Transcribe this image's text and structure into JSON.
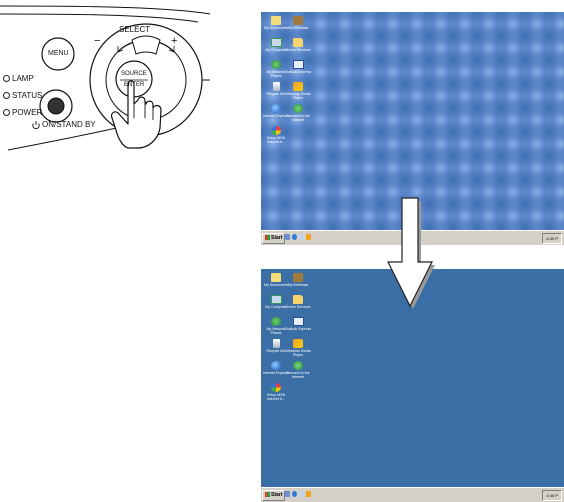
{
  "panel": {
    "select_label": "SELECT",
    "minus_label": "−",
    "plus_label": "+",
    "menu_label": "MENU",
    "source_label": "SOURCE",
    "enter_label": "ENTER",
    "lamp_label": "LAMP",
    "status_label": "STATUS",
    "power_label": "POWER",
    "standby_label": "ON/STAND BY"
  },
  "screens": {
    "before": {
      "background": "#5a86c8",
      "icons": [
        {
          "icon": "documents-icon",
          "label": "My Documents"
        },
        {
          "icon": "briefcase-icon",
          "label": "My Briefcase"
        },
        {
          "icon": "computer-icon",
          "label": "My Computer"
        },
        {
          "icon": "folder-icon",
          "label": "Online Services"
        },
        {
          "icon": "network-icon",
          "label": "My Network Places"
        },
        {
          "icon": "outlook-icon",
          "label": "Outlook Express"
        },
        {
          "icon": "recycle-bin-icon",
          "label": "Recycle Bin"
        },
        {
          "icon": "media-player-icon",
          "label": "Windows Media Player"
        },
        {
          "icon": "internet-explorer-icon",
          "label": "Internet Explorer"
        },
        {
          "icon": "connect-icon",
          "label": "Connect to the Internet"
        },
        {
          "icon": "msn-icon",
          "label": "Setup MSN Internet A..."
        }
      ],
      "start_label": "Start",
      "clock": "4:40 P"
    },
    "after": {
      "background": "#3a6ea5",
      "icons": [
        {
          "icon": "documents-icon",
          "label": "My Documents"
        },
        {
          "icon": "briefcase-icon",
          "label": "My Briefcase"
        },
        {
          "icon": "computer-icon",
          "label": "My Computer"
        },
        {
          "icon": "folder-icon",
          "label": "Online Services"
        },
        {
          "icon": "network-icon",
          "label": "My Network Places"
        },
        {
          "icon": "outlook-icon",
          "label": "Outlook Express"
        },
        {
          "icon": "recycle-bin-icon",
          "label": "Recycle Bin"
        },
        {
          "icon": "media-player-icon",
          "label": "Windows Media Player"
        },
        {
          "icon": "internet-explorer-icon",
          "label": "Internet Explorer"
        },
        {
          "icon": "connect-icon",
          "label": "Connect to the Internet"
        },
        {
          "icon": "msn-icon",
          "label": "Setup MSN Internet A..."
        }
      ],
      "start_label": "Start",
      "clock": "4:40 P"
    }
  },
  "colors": {
    "arrow_fill": "#ffffff",
    "arrow_stroke": "#222222",
    "arrow_shadow": "#9a9a9a"
  }
}
